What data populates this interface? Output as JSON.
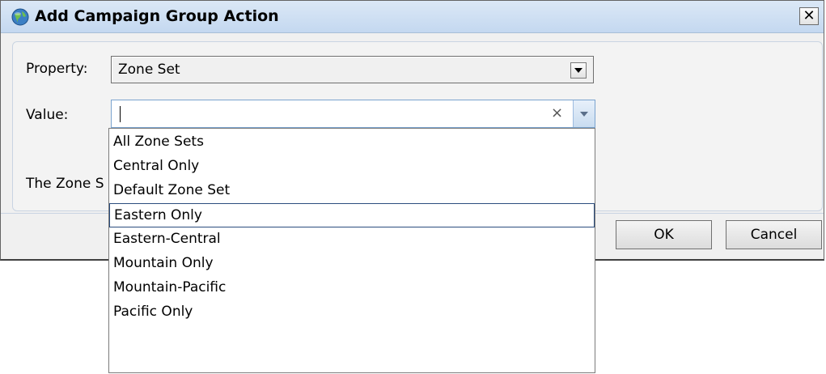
{
  "window": {
    "title": "Add Campaign Group Action",
    "close_glyph": "✕"
  },
  "form": {
    "property_label": "Property:",
    "property_value": "Zone Set",
    "value_label": "Value:",
    "value_input": "",
    "clear_glyph": "×",
    "description_partial": "The Zone S"
  },
  "dropdown": {
    "options": [
      "All Zone Sets",
      "Central Only",
      "Default Zone Set",
      "Eastern Only",
      "Eastern-Central",
      "Mountain Only",
      "Mountain-Pacific",
      "Pacific Only"
    ],
    "highlighted": "Eastern Only"
  },
  "buttons": {
    "ok": "OK",
    "cancel": "Cancel"
  },
  "icons": {
    "title": "globe-icon",
    "close": "close-icon",
    "dropdown_arrow": "chevron-down-icon"
  },
  "colors": {
    "titlebar": "#c4d8f0",
    "dialog_bg": "#f0f0f0",
    "input_border_focus": "#7aa3cf",
    "selected_item_border": "#2b4d7e"
  }
}
